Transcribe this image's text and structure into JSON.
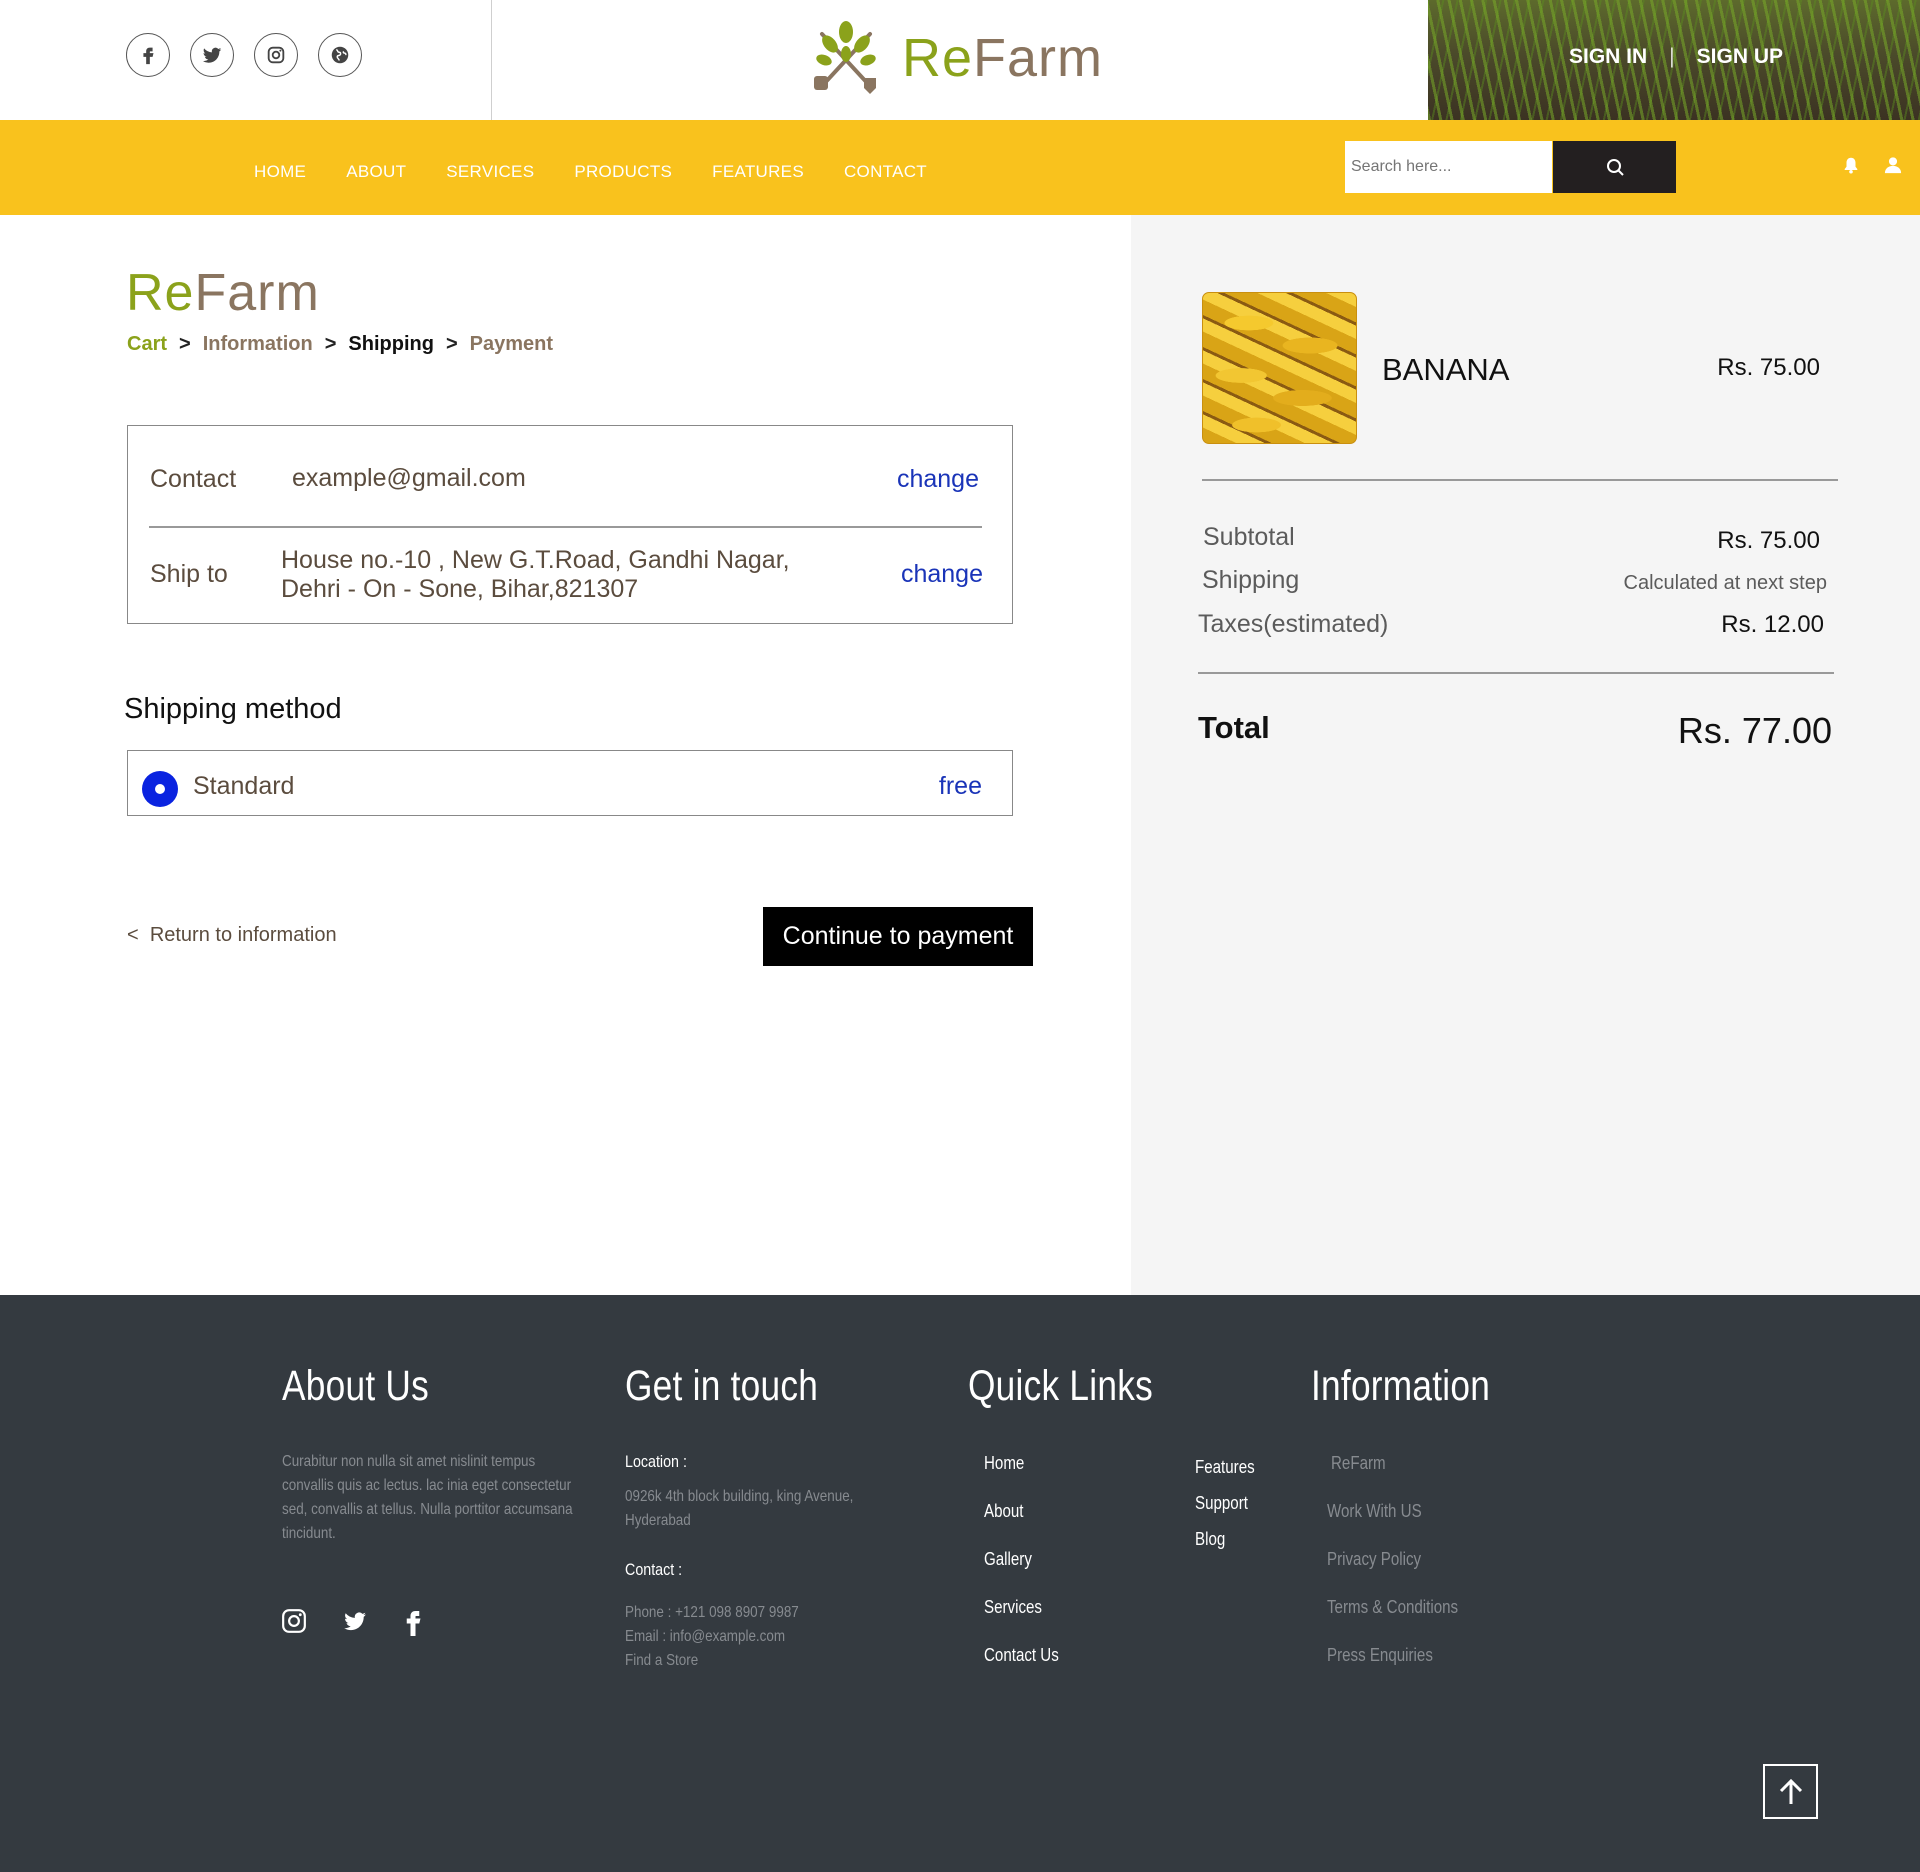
{
  "header": {
    "brand_re": "Re",
    "brand_farm": "Farm",
    "sign_in": "SIGN IN",
    "separator": "|",
    "sign_up": "SIGN UP",
    "social_icons": [
      "facebook-icon",
      "twitter-icon",
      "instagram-icon",
      "globe-icon"
    ]
  },
  "nav": {
    "items": [
      "HOME",
      "ABOUT",
      "SERVICES",
      "PRODUCTS",
      "FEATURES",
      "CONTACT"
    ],
    "search_placeholder": "Search here...",
    "icons": [
      "search-icon",
      "bell-icon",
      "user-icon"
    ]
  },
  "checkout": {
    "brand_re": "Re",
    "brand_farm": "Farm",
    "breadcrumb": {
      "cart": "Cart",
      "information": "Information",
      "shipping": "Shipping",
      "payment": "Payment",
      "sep": ">"
    },
    "contact_label": "Contact",
    "contact_value": "example@gmail.com",
    "ship_to_label": "Ship to",
    "ship_to_line1": "House no.-10 , New G.T.Road, Gandhi Nagar,",
    "ship_to_line2": "Dehri - On - Sone, Bihar,821307",
    "change_label": "change",
    "shipping_method_title": "Shipping method",
    "method_label": "Standard",
    "method_price": "free",
    "return_prefix": "<",
    "return_label": "Return to information",
    "continue_label": "Continue to payment"
  },
  "summary": {
    "product_name": "BANANA",
    "product_price": "Rs. 75.00",
    "subtotal_label": "Subtotal",
    "subtotal_value": "Rs. 75.00",
    "shipping_label": "Shipping",
    "shipping_value": "Calculated at next step",
    "taxes_label": "Taxes(estimated)",
    "taxes_value": "Rs. 12.00",
    "total_label": "Total",
    "total_value": "Rs. 77.00"
  },
  "footer": {
    "about_title": "About Us",
    "about_text_1": "Curabitur non nulla sit amet nislinit tempus",
    "about_text_2": "convallis quis ac lectus. lac inia eget consectetur",
    "about_text_3": " sed, convallis at tellus. Nulla porttitor accumsana",
    "about_text_4": " tincidunt.",
    "touch_title": "Get in touch",
    "location_label": "Location :",
    "location_1": "0926k 4th block building, king Avenue,",
    "location_2": "Hyderabad",
    "contact_label": "Contact :",
    "phone": "Phone : +121 098 8907 9987",
    "email": "Email : info@example.com",
    "store": "Find a Store",
    "quick_title": "Quick Links",
    "quick_col1": [
      "Home",
      "About",
      "Gallery",
      "Services",
      "Contact Us"
    ],
    "quick_col2": [
      "Features",
      "Support",
      "Blog"
    ],
    "info_title": "Information",
    "info_links": [
      "ReFarm",
      "Work With US",
      "Privacy Policy",
      "Terms & Conditions",
      "Press Enquiries"
    ]
  },
  "colors": {
    "nav_bg": "#f9c21d",
    "brand_green": "#8ba21b",
    "brand_brown": "#8a7560",
    "link_blue": "#1a34b8",
    "footer_bg": "#343a40"
  }
}
